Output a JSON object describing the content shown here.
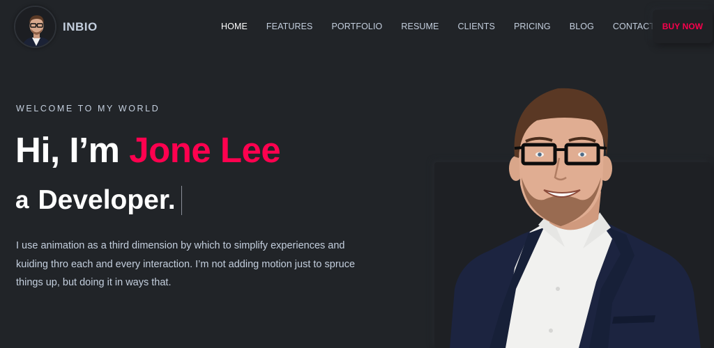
{
  "header": {
    "logo_text": "INBIO",
    "logo_avatar_alt": "avatar",
    "nav": [
      {
        "label": "HOME",
        "active": true
      },
      {
        "label": "FEATURES",
        "active": false
      },
      {
        "label": "PORTFOLIO",
        "active": false
      },
      {
        "label": "RESUME",
        "active": false
      },
      {
        "label": "CLIENTS",
        "active": false
      },
      {
        "label": "PRICING",
        "active": false
      },
      {
        "label": "BLOG",
        "active": false
      },
      {
        "label": "CONTACT",
        "active": false
      }
    ],
    "buy_button": "BUY NOW"
  },
  "hero": {
    "welcome": "WELCOME TO MY WORLD",
    "greeting": "Hi, I’m ",
    "name": "Jone Lee",
    "role_prefix": "a",
    "role": "Developer.",
    "description": "I use animation as a third dimension by which to simplify experiences and kuiding thro each and every interaction. I’m not adding motion just to spruce things up, but doing it in ways that."
  },
  "colors": {
    "background": "#212428",
    "accent": "#ff014f",
    "text": "#c4cfde",
    "heading": "#ffffff"
  }
}
